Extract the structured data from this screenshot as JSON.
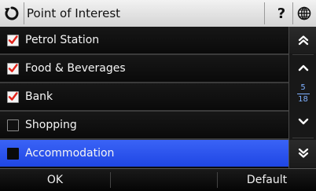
{
  "header": {
    "title": "Point of Interest",
    "back_icon": "refresh-back-icon",
    "help_label": "?",
    "globe_icon": "globe-icon"
  },
  "list": {
    "items": [
      {
        "label": "Petrol Station",
        "checked": true,
        "selected": false
      },
      {
        "label": "Food & Beverages",
        "checked": true,
        "selected": false
      },
      {
        "label": "Bank",
        "checked": true,
        "selected": false
      },
      {
        "label": "Shopping",
        "checked": false,
        "selected": false
      },
      {
        "label": "Accommodation",
        "checked": false,
        "selected": true
      }
    ]
  },
  "pager": {
    "current": "5",
    "total": "18"
  },
  "footer": {
    "ok_label": "OK",
    "default_label": "Default"
  },
  "colors": {
    "check_red": "#e2231a",
    "selected_blue": "#2c55ee",
    "page_indicator": "#7fb0ff"
  }
}
